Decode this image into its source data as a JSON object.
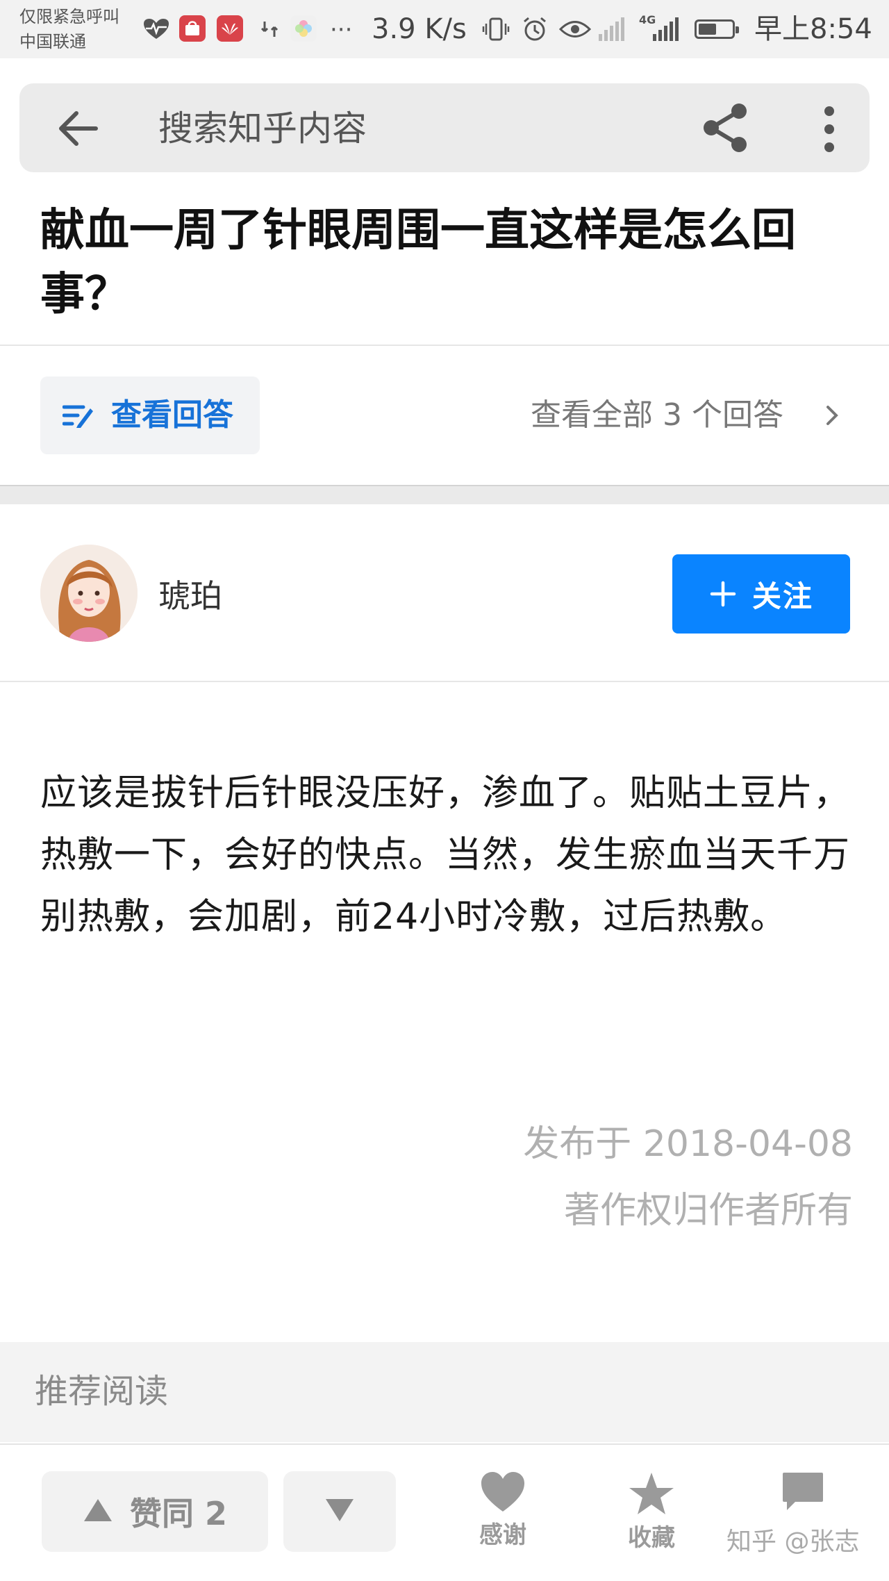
{
  "status_bar": {
    "carrier_line1": "仅限紧急呼叫",
    "carrier_line2": "中国联通",
    "more_indicator": "···",
    "net_speed": "3.9 K/s",
    "signal_label": "4G",
    "battery_level": 0.55,
    "time": "早上8:54"
  },
  "search": {
    "placeholder": "搜索知乎内容"
  },
  "question": {
    "title": "献血一周了针眼周围一直这样是怎么回事？"
  },
  "answers_nav": {
    "view_answer_label": "查看回答",
    "all_answers_label": "查看全部 3 个回答"
  },
  "author": {
    "name": "琥珀",
    "follow_label": "关注"
  },
  "answer": {
    "body": "应该是拔针后针眼没压好，渗血了。贴贴土豆片，热敷一下，会好的快点。当然，发生瘀血当天千万别热敷，会加剧，前24小时冷敷，过后热敷。",
    "publish_date": "发布于 2018-04-08",
    "copyright": "著作权归作者所有"
  },
  "recommend": {
    "label": "推荐阅读"
  },
  "bottom_bar": {
    "upvote_label": "赞同 2",
    "thanks_label": "感谢",
    "collect_label": "收藏",
    "comment_label": ""
  },
  "watermark": "知乎 @张志",
  "colors": {
    "accent_blue": "#0a84ff",
    "link_blue": "#1772d8",
    "muted_gray": "#b0b0b0"
  }
}
